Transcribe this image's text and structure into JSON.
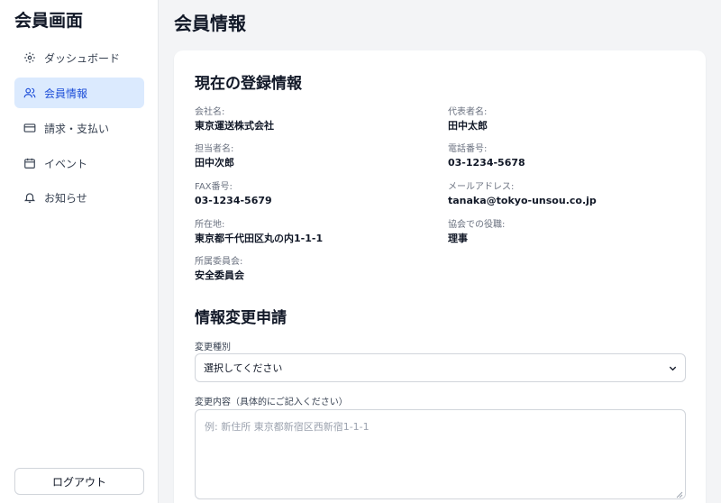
{
  "sidebar": {
    "title": "会員画面",
    "items": [
      {
        "label": "ダッシュボード",
        "icon": "gear-icon"
      },
      {
        "label": "会員情報",
        "icon": "users-icon",
        "active": true
      },
      {
        "label": "請求・支払い",
        "icon": "credit-card-icon"
      },
      {
        "label": "イベント",
        "icon": "calendar-icon"
      },
      {
        "label": "お知らせ",
        "icon": "bell-icon"
      }
    ],
    "logout_label": "ログアウト"
  },
  "header": {
    "title": "会員情報"
  },
  "registration": {
    "title": "現在の登録情報",
    "fields": [
      {
        "label": "会社名:",
        "value": "東京運送株式会社"
      },
      {
        "label": "代表者名:",
        "value": "田中太郎"
      },
      {
        "label": "担当者名:",
        "value": "田中次郎"
      },
      {
        "label": "電話番号:",
        "value": "03-1234-5678"
      },
      {
        "label": "FAX番号:",
        "value": "03-1234-5679"
      },
      {
        "label": "メールアドレス:",
        "value": "tanaka@tokyo-unsou.co.jp"
      },
      {
        "label": "所在地:",
        "value": "東京都千代田区丸の内1-1-1"
      },
      {
        "label": "協会での役職:",
        "value": "理事"
      },
      {
        "label": "所属委員会:",
        "value": "安全委員会"
      }
    ]
  },
  "change_request": {
    "title": "情報変更申請",
    "type_label": "変更種別",
    "type_selected": "選択してください",
    "content_label": "変更内容（具体的にご記入ください）",
    "content_placeholder": "例: 新住所 東京都新宿区西新宿1-1-1"
  },
  "colors": {
    "accent": "#1d4ed8",
    "active_bg": "#dbeafe",
    "background": "#f3f4f6"
  }
}
